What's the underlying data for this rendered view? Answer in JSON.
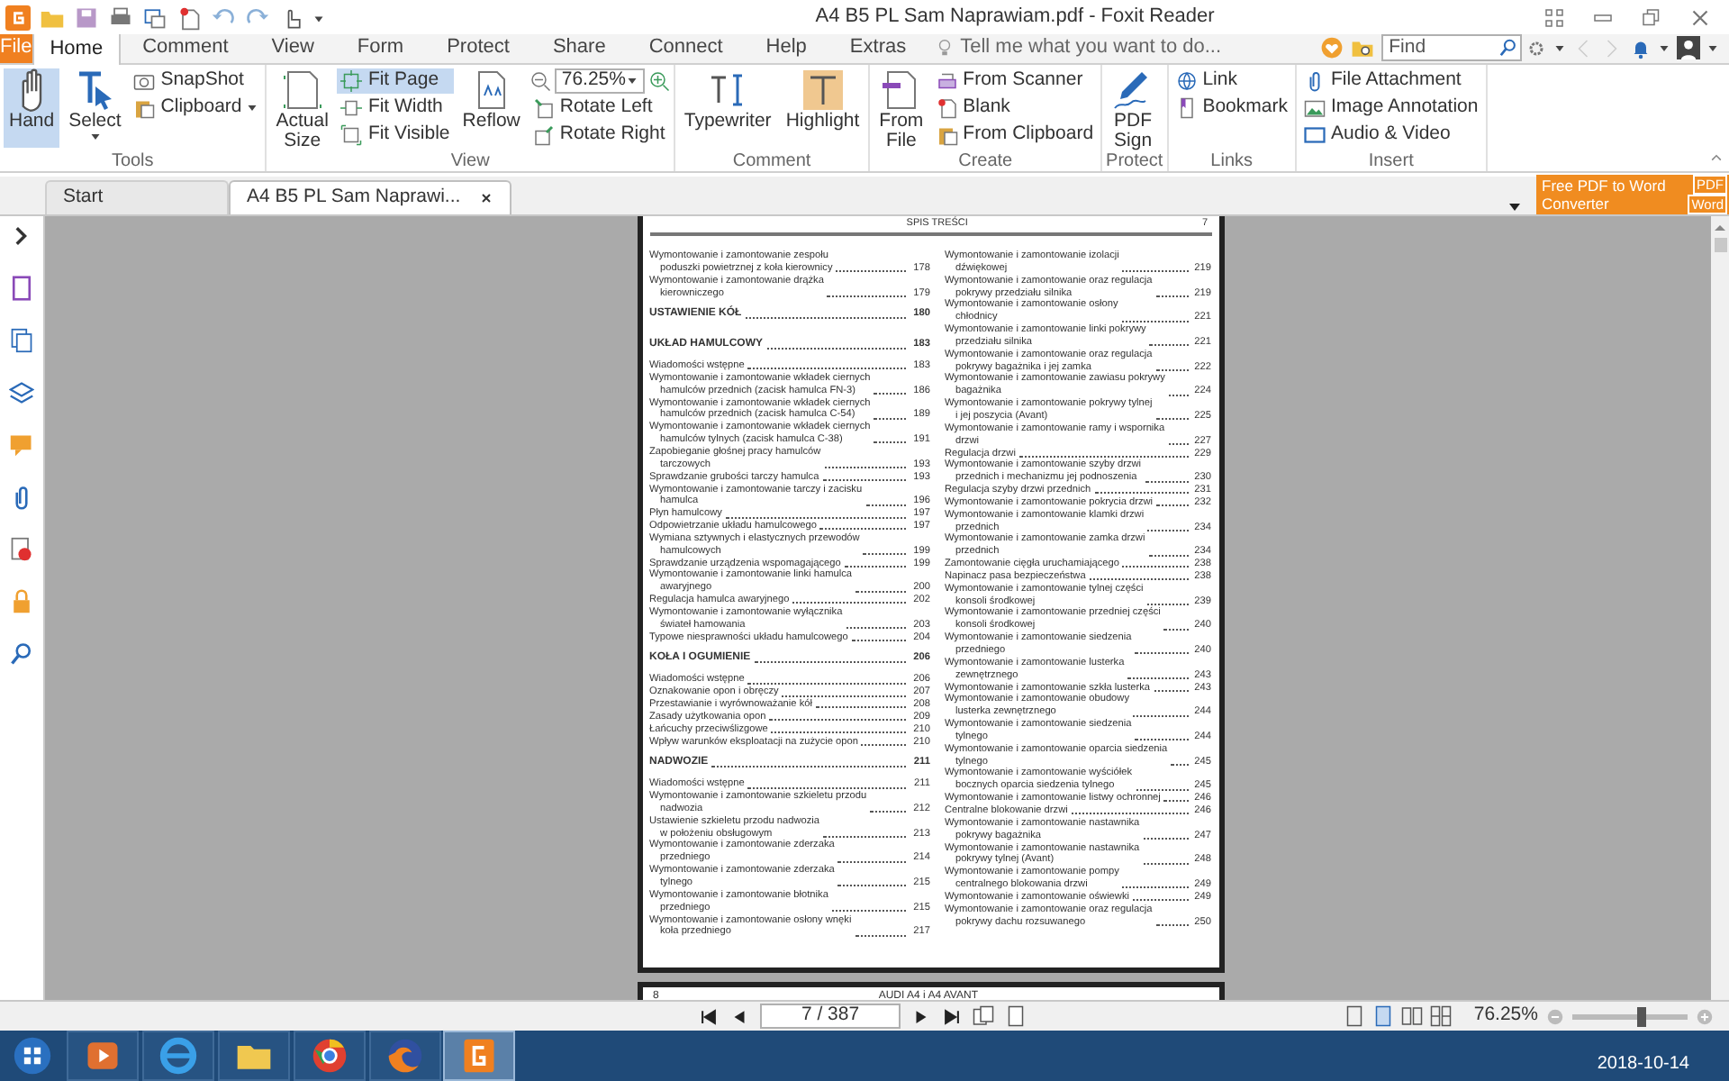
{
  "window": {
    "title": "A4 B5 PL Sam Naprawiam.pdf - Foxit Reader"
  },
  "menu_tabs": [
    {
      "label": "File",
      "kind": "file",
      "selected": false
    },
    {
      "label": "Home",
      "kind": "tab",
      "selected": true
    },
    {
      "label": "Comment",
      "kind": "tab",
      "selected": false
    },
    {
      "label": "View",
      "kind": "tab",
      "selected": false
    },
    {
      "label": "Form",
      "kind": "tab",
      "selected": false
    },
    {
      "label": "Protect",
      "kind": "tab",
      "selected": false
    },
    {
      "label": "Share",
      "kind": "tab",
      "selected": false
    },
    {
      "label": "Connect",
      "kind": "tab",
      "selected": false
    },
    {
      "label": "Help",
      "kind": "tab",
      "selected": false
    },
    {
      "label": "Extras",
      "kind": "tab",
      "selected": false
    }
  ],
  "tell_me": {
    "placeholder": "Tell me what you want to do..."
  },
  "find": {
    "placeholder": "Find"
  },
  "ribbon": [
    {
      "label": "Tools",
      "items": [
        {
          "kind": "large",
          "label": "Hand",
          "selected": true
        },
        {
          "kind": "large",
          "label": "Select",
          "selected": false,
          "dropdown": true
        },
        {
          "kind": "stack",
          "items": [
            {
              "label": "SnapShot",
              "selected": false
            },
            {
              "label": "Clipboard",
              "selected": false,
              "dropdown": true
            }
          ]
        }
      ]
    },
    {
      "label": "View",
      "items": [
        {
          "kind": "large",
          "label": "Actual Size",
          "selected": false
        },
        {
          "kind": "stack",
          "items": [
            {
              "label": "Fit Page",
              "selected": true
            },
            {
              "label": "Fit Width",
              "selected": false
            },
            {
              "label": "Fit Visible",
              "selected": false
            }
          ]
        },
        {
          "kind": "large",
          "label": "Reflow",
          "selected": false
        },
        {
          "kind": "stack",
          "items": [
            {
              "kind": "zoom",
              "value": "76.25%"
            },
            {
              "label": "Rotate Left",
              "selected": false
            },
            {
              "label": "Rotate Right",
              "selected": false
            }
          ]
        }
      ]
    },
    {
      "label": "Comment",
      "items": [
        {
          "kind": "large",
          "label": "Typewriter",
          "selected": false
        },
        {
          "kind": "large",
          "label": "Highlight",
          "selected": false
        }
      ]
    },
    {
      "label": "Create",
      "items": [
        {
          "kind": "large",
          "label": "From File",
          "selected": false
        },
        {
          "kind": "stack",
          "items": [
            {
              "label": "From Scanner",
              "selected": false
            },
            {
              "label": "Blank",
              "selected": false
            },
            {
              "label": "From Clipboard",
              "selected": false
            }
          ]
        }
      ]
    },
    {
      "label": "Protect",
      "items": [
        {
          "kind": "large",
          "label": "PDF Sign",
          "selected": false
        }
      ]
    },
    {
      "label": "Links",
      "items": [
        {
          "kind": "stack",
          "items": [
            {
              "label": "Link",
              "selected": false
            },
            {
              "label": "Bookmark",
              "selected": false
            }
          ]
        }
      ]
    },
    {
      "label": "Insert",
      "items": [
        {
          "kind": "stack",
          "items": [
            {
              "label": "File Attachment",
              "selected": false
            },
            {
              "label": "Image Annotation",
              "selected": false
            },
            {
              "label": "Audio & Video",
              "selected": false
            }
          ]
        }
      ]
    }
  ],
  "doc_tabs": [
    {
      "label": "Start",
      "selected": false
    },
    {
      "label": "A4 B5 PL Sam Naprawi...",
      "selected": true,
      "closable": true
    }
  ],
  "promo": {
    "lines": [
      "Free PDF to Word",
      "Converter"
    ],
    "badges": [
      "PDF",
      "Word"
    ]
  },
  "page": {
    "header": "SPIS TREŚCI",
    "number": "7",
    "columns": [
      [
        {
          "kind": "entry",
          "lines": [
            "Wymontowanie i zamontowanie zespołu",
            "poduszki powietrznej z koła kierownicy"
          ],
          "page": "178"
        },
        {
          "kind": "entry",
          "lines": [
            "Wymontowanie i zamontowanie drążka",
            "kierowniczego"
          ],
          "page": "179"
        },
        {
          "kind": "heading",
          "lines": [
            "USTAWIENIE KÓŁ"
          ],
          "page": "180"
        },
        {
          "kind": "heading",
          "lines": [
            "UKŁAD HAMULCOWY"
          ],
          "page": "183"
        },
        {
          "kind": "entry",
          "lines": [
            "Wiadomości wstępne"
          ],
          "page": "183"
        },
        {
          "kind": "entry",
          "lines": [
            "Wymontowanie i zamontowanie wkładek ciernych",
            "hamulców przednich (zacisk hamulca FN-3)"
          ],
          "page": "186"
        },
        {
          "kind": "entry",
          "lines": [
            "Wymontowanie i zamontowanie wkładek ciernych",
            "hamulców przednich (zacisk hamulca C-54)"
          ],
          "page": "189"
        },
        {
          "kind": "entry",
          "lines": [
            "Wymontowanie i zamontowanie wkładek ciernych",
            "hamulców tylnych (zacisk hamulca C-38)"
          ],
          "page": "191"
        },
        {
          "kind": "entry",
          "lines": [
            "Zapobieganie głośnej pracy hamulców",
            "tarczowych"
          ],
          "page": "193"
        },
        {
          "kind": "entry",
          "lines": [
            "Sprawdzanie grubości tarczy hamulca"
          ],
          "page": "193"
        },
        {
          "kind": "entry",
          "lines": [
            "Wymontowanie i zamontowanie tarczy i zacisku",
            "hamulca"
          ],
          "page": "196"
        },
        {
          "kind": "entry",
          "lines": [
            "Płyn hamulcowy"
          ],
          "page": "197"
        },
        {
          "kind": "entry",
          "lines": [
            "Odpowietrzanie układu hamulcowego"
          ],
          "page": "197"
        },
        {
          "kind": "entry",
          "lines": [
            "Wymiana sztywnych i elastycznych przewodów",
            "hamulcowych"
          ],
          "page": "199"
        },
        {
          "kind": "entry",
          "lines": [
            "Sprawdzanie urządzenia wspomagającego"
          ],
          "page": "199"
        },
        {
          "kind": "entry",
          "lines": [
            "Wymontowanie i zamontowanie linki hamulca",
            "awaryjnego"
          ],
          "page": "200"
        },
        {
          "kind": "entry",
          "lines": [
            "Regulacja hamulca awaryjnego"
          ],
          "page": "202"
        },
        {
          "kind": "entry",
          "lines": [
            "Wymontowanie i zamontowanie wyłącznika",
            "świateł hamowania"
          ],
          "page": "203"
        },
        {
          "kind": "entry",
          "lines": [
            "Typowe niesprawności układu hamulcowego"
          ],
          "page": "204"
        },
        {
          "kind": "heading",
          "lines": [
            "KOŁA I OGUMIENIE"
          ],
          "page": "206"
        },
        {
          "kind": "entry",
          "lines": [
            "Wiadomości wstępne"
          ],
          "page": "206"
        },
        {
          "kind": "entry",
          "lines": [
            "Oznakowanie opon i obręczy"
          ],
          "page": "207"
        },
        {
          "kind": "entry",
          "lines": [
            "Przestawianie i wyrównoważanie kół"
          ],
          "page": "208"
        },
        {
          "kind": "entry",
          "lines": [
            "Zasady użytkowania opon"
          ],
          "page": "209"
        },
        {
          "kind": "entry",
          "lines": [
            "Łańcuchy przeciwślizgowe"
          ],
          "page": "210"
        },
        {
          "kind": "entry",
          "lines": [
            "Wpływ warunków eksploatacji na zużycie opon"
          ],
          "page": "210"
        },
        {
          "kind": "heading",
          "lines": [
            "NADWOZIE"
          ],
          "page": "211"
        },
        {
          "kind": "entry",
          "lines": [
            "Wiadomości wstępne"
          ],
          "page": "211"
        },
        {
          "kind": "entry",
          "lines": [
            "Wymontowanie i zamontowanie szkieletu przodu",
            "nadwozia"
          ],
          "page": "212"
        },
        {
          "kind": "entry",
          "lines": [
            "Ustawienie szkieletu przodu nadwozia",
            "w położeniu obsługowym"
          ],
          "page": "213"
        },
        {
          "kind": "entry",
          "lines": [
            "Wymontowanie i zamontowanie zderzaka",
            "przedniego"
          ],
          "page": "214"
        },
        {
          "kind": "entry",
          "lines": [
            "Wymontowanie i zamontowanie zderzaka",
            "tylnego"
          ],
          "page": "215"
        },
        {
          "kind": "entry",
          "lines": [
            "Wymontowanie i zamontowanie błotnika",
            "przedniego"
          ],
          "page": "215"
        },
        {
          "kind": "entry",
          "lines": [
            "Wymontowanie i zamontowanie osłony wnęki",
            "koła przedniego"
          ],
          "page": "217"
        }
      ],
      [
        {
          "kind": "entry",
          "lines": [
            "Wymontowanie i zamontowanie izolacji",
            "dźwiękowej"
          ],
          "page": "219"
        },
        {
          "kind": "entry",
          "lines": [
            "Wymontowanie i zamontowanie oraz regulacja",
            "pokrywy przedziału silnika"
          ],
          "page": "219"
        },
        {
          "kind": "entry",
          "lines": [
            "Wymontowanie i zamontowanie osłony",
            "chłodnicy"
          ],
          "page": "221"
        },
        {
          "kind": "entry",
          "lines": [
            "Wymontowanie i zamontowanie linki pokrywy",
            "przedziału silnika"
          ],
          "page": "221"
        },
        {
          "kind": "entry",
          "lines": [
            "Wymontowanie i zamontowanie oraz regulacja",
            "pokrywy bagażnika i jej zamka"
          ],
          "page": "222"
        },
        {
          "kind": "entry",
          "lines": [
            "Wymontowanie i zamontowanie zawiasu pokrywy",
            "bagażnika"
          ],
          "page": "224"
        },
        {
          "kind": "entry",
          "lines": [
            "Wymontowanie i zamontowanie pokrywy tylnej",
            "i jej poszycia (Avant)"
          ],
          "page": "225"
        },
        {
          "kind": "entry",
          "lines": [
            "Wymontowanie i zamontowanie ramy i wspornika",
            "drzwi"
          ],
          "page": "227"
        },
        {
          "kind": "entry",
          "lines": [
            "Regulacja drzwi"
          ],
          "page": "229"
        },
        {
          "kind": "entry",
          "lines": [
            "Wymontowanie i zamontowanie szyby drzwi",
            "przednich i mechanizmu jej podnoszenia"
          ],
          "page": "230"
        },
        {
          "kind": "entry",
          "lines": [
            "Regulacja szyby drzwi przednich"
          ],
          "page": "231"
        },
        {
          "kind": "entry",
          "lines": [
            "Wymontowanie i zamontowanie pokrycia drzwi"
          ],
          "page": "232"
        },
        {
          "kind": "entry",
          "lines": [
            "Wymontowanie i zamontowanie klamki drzwi",
            "przednich"
          ],
          "page": "234"
        },
        {
          "kind": "entry",
          "lines": [
            "Wymontowanie i zamontowanie zamka drzwi",
            "przednich"
          ],
          "page": "234"
        },
        {
          "kind": "entry",
          "lines": [
            "Zamontowanie cięgła uruchamiającego"
          ],
          "page": "238"
        },
        {
          "kind": "entry",
          "lines": [
            "Napinacz pasa bezpieczeństwa"
          ],
          "page": "238"
        },
        {
          "kind": "entry",
          "lines": [
            "Wymontowanie i zamontowanie tylnej części",
            "konsoli środkowej"
          ],
          "page": "239"
        },
        {
          "kind": "entry",
          "lines": [
            "Wymontowanie i zamontowanie przedniej części",
            "konsoli środkowej"
          ],
          "page": "240"
        },
        {
          "kind": "entry",
          "lines": [
            "Wymontowanie i zamontowanie siedzenia",
            "przedniego"
          ],
          "page": "240"
        },
        {
          "kind": "entry",
          "lines": [
            "Wymontowanie i zamontowanie lusterka",
            "zewnętrznego"
          ],
          "page": "243"
        },
        {
          "kind": "entry",
          "lines": [
            "Wymontowanie i zamontowanie szkła lusterka"
          ],
          "page": "243"
        },
        {
          "kind": "entry",
          "lines": [
            "Wymontowanie i zamontowanie obudowy",
            "lusterka zewnętrznego"
          ],
          "page": "244"
        },
        {
          "kind": "entry",
          "lines": [
            "Wymontowanie i zamontowanie siedzenia",
            "tylnego"
          ],
          "page": "244"
        },
        {
          "kind": "entry",
          "lines": [
            "Wymontowanie i zamontowanie oparcia siedzenia",
            "tylnego"
          ],
          "page": "245"
        },
        {
          "kind": "entry",
          "lines": [
            "Wymontowanie i zamontowanie wyściółek",
            "bocznych oparcia siedzenia tylnego"
          ],
          "page": "245"
        },
        {
          "kind": "entry",
          "lines": [
            "Wymontowanie i zamontowanie listwy ochronnej"
          ],
          "page": "246"
        },
        {
          "kind": "entry",
          "lines": [
            "Centralne blokowanie drzwi"
          ],
          "page": "246"
        },
        {
          "kind": "entry",
          "lines": [
            "Wymontowanie i zamontowanie nastawnika",
            "pokrywy bagażnika"
          ],
          "page": "247"
        },
        {
          "kind": "entry",
          "lines": [
            "Wymontowanie i zamontowanie nastawnika",
            "pokrywy tylnej (Avant)"
          ],
          "page": "248"
        },
        {
          "kind": "entry",
          "lines": [
            "Wymontowanie i zamontowanie pompy",
            "centralnego blokowania drzwi"
          ],
          "page": "249"
        },
        {
          "kind": "entry",
          "lines": [
            "Wymontowanie i zamontowanie oświewki"
          ],
          "page": "249"
        },
        {
          "kind": "entry",
          "lines": [
            "Wymontowanie i zamontowanie oraz regulacja",
            "pokrywy dachu rozsuwanego"
          ],
          "page": "250"
        }
      ]
    ]
  },
  "next_page": {
    "number": "8",
    "header": "AUDI A4 i A4 AVANT"
  },
  "status_bar": {
    "page_field": "7 / 387",
    "zoom": "76.25%",
    "zoom_slider": {
      "level": 0.6
    }
  },
  "taskbar": {
    "date": "2018-10-14"
  }
}
